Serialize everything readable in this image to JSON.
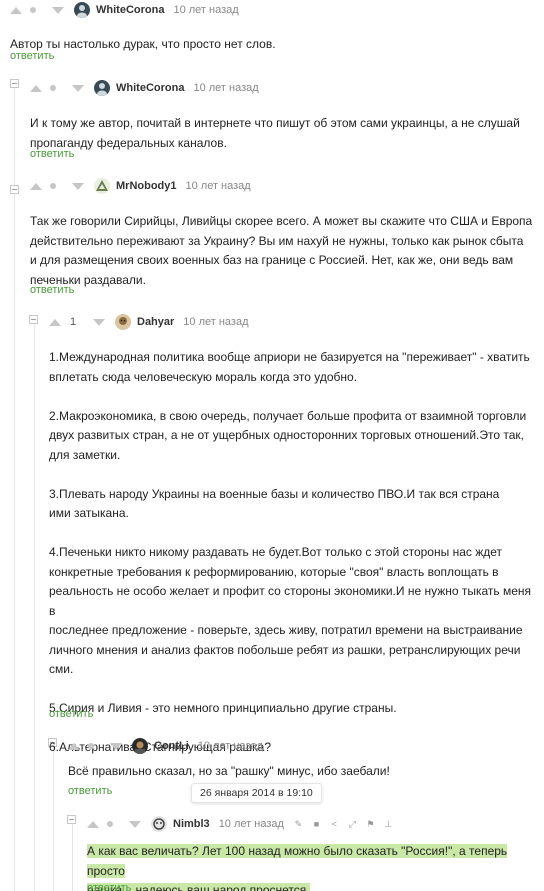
{
  "reply_label": "ответить",
  "comments": [
    {
      "author": "WhiteCorona",
      "time": "10 лет назад",
      "score": "",
      "lines": [
        "Автор ты настолько дурак, что просто нет слов."
      ]
    },
    {
      "author": "WhiteCorona",
      "time": "10 лет назад",
      "score": "",
      "lines": [
        "И к тому же автор, почитай в интернете что пишут об этом сами украинцы, а не слушай",
        "пропаганду федеральных каналов."
      ]
    },
    {
      "author": "MrNobody1",
      "time": "10 лет назад",
      "score": "",
      "lines": [
        "Так же говорили Сирийцы, Ливийцы скорее всего. А может вы скажите что США и Европа",
        "действительно переживают за Украину? Вы им нахуй не нужны, только как рынок сбыта",
        "и для размещения своих военных баз на границе с Россией. Нет, как же, они ведь вам",
        "печеньки раздавали."
      ]
    },
    {
      "author": "Dahyar",
      "time": "10 лет назад",
      "score": "1",
      "lines": [
        "1.Международная политика вообще априори не базируется на \"переживает\" - хватить",
        "вплетать сюда человеческую мораль когда это удобно.",
        "",
        "2.Макроэкономика, в свою очередь, получает больше профита от взаимной торговли",
        "двух развитых стран, а не от ущербных односторонних торговых отношений.Это так,",
        "для заметки.",
        "",
        "3.Плевать народу Украины на военные базы и количество ПВО.И так вся страна",
        "ими затыкана.",
        "",
        "4.Печеньки никто никому раздавать не будет.Вот только с этой стороны нас ждет",
        "конкретные требования к реформированию, которые \"своя\" власть воплощать в",
        "реальность не особо желает и профит со стороны экономики.И не нужно тыкать меня в",
        "последнее предложение - поверьте, здесь живу, потратил времени на выстраивание",
        "личного мнения и анализ фактов побольше ребят из рашки, ретранслирующих речи сми.",
        "",
        "5.Сирия и Ливия - это немного принципиально другие страны.",
        "",
        "6.Альтернатива?Стагнирующая рашка?"
      ]
    },
    {
      "author": "ContLi",
      "time": "10 лет назад",
      "score": "",
      "lines": [
        "Всё правильно сказал, но за \"рашку\" минус, ибо заебали!"
      ]
    },
    {
      "author": "Nimbl3",
      "time": "10 лет назад",
      "score": "",
      "lines": [
        "А как вас величать? Лет 100 назад можно было сказать \"Россия!\", а теперь просто",
        "рашка... надеюсь ваш народ проснется."
      ]
    }
  ],
  "tooltip": "26 января 2014 в 19:10",
  "colors": {
    "reply": "#4a9a3a",
    "highlight": "#c9e7a6"
  }
}
